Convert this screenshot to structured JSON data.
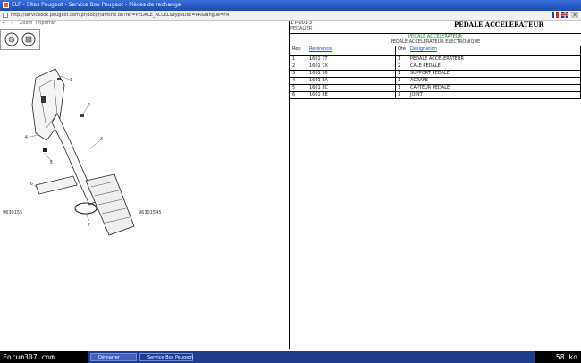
{
  "window": {
    "title": "ELF - Sites Peugeot - Service Box Peugeot - Pièces de rechange",
    "address": "http://servicebox.peugeot.com/pr/docpr/affiche.do?ref=PEDALE_ACCEL&typeDoc=PR&langue=FR"
  },
  "toolbar": {
    "items": [
      "+",
      "-",
      "Zoom",
      "Imprimer"
    ]
  },
  "diagram": {
    "callouts": [
      "1",
      "2",
      "3",
      "4",
      "5",
      "6",
      "7"
    ],
    "ref_left": "9630155",
    "ref_right": "96301545"
  },
  "detail": {
    "code": "1 P-001-3",
    "subtitle": "PEDALIER",
    "title": "PEDALE ACCELERATEUR",
    "section_green": "PEDALE ACCELERATEUR",
    "section_sub": "PEDALE ACCELERATEUR ELECTRONIQUE",
    "table": {
      "headers": [
        "Rep",
        "Référence",
        "Qté",
        "Désignation"
      ],
      "rows": [
        {
          "ref": "1",
          "num": "1601 7T",
          "qty": "1",
          "desc": "PEDALE ACCELERATEUR"
        },
        {
          "ref": "2",
          "num": "1601 7X",
          "qty": "2",
          "desc": "CALE PEDALE"
        },
        {
          "ref": "3",
          "num": "1601 90",
          "qty": "1",
          "desc": "SUPPORT PEDALE"
        },
        {
          "ref": "4",
          "num": "1601 8A",
          "qty": "1",
          "desc": "AGRAFE"
        },
        {
          "ref": "5",
          "num": "1601 8C",
          "qty": "1",
          "desc": "CAPTEUR PEDALE"
        },
        {
          "ref": "6",
          "num": "1601 8E",
          "qty": "1",
          "desc": "JOINT"
        }
      ]
    }
  },
  "taskbar": {
    "brand": "Forum307.com",
    "tasks": [
      "Démarrer",
      "Service Box Peugeot"
    ],
    "size": "58 ko"
  }
}
